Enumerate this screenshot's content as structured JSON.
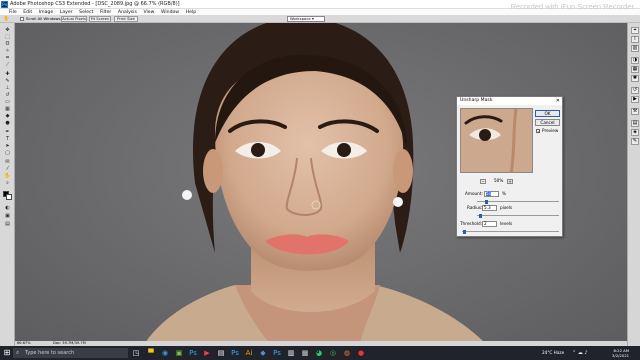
{
  "app": {
    "title": "Adobe Photoshop CS3 Extended - [DSC_2089.jpg @ 66.7% (RGB/8)]",
    "watermark": "Recorded with iFun Screen Recorder"
  },
  "menu": [
    "File",
    "Edit",
    "Image",
    "Layer",
    "Select",
    "Filter",
    "Analysis",
    "View",
    "Window",
    "Help"
  ],
  "options": {
    "scroll_all_label": "Scroll All Windows",
    "actual_pixels": "Actual Pixels",
    "fit_screen": "Fit Screen",
    "print_size": "Print Size",
    "workspace": "Workspace ▾"
  },
  "status": {
    "zoom": "66.67%",
    "doc": "Doc: 39.7M/39.7M"
  },
  "dialog": {
    "title": "Unsharp Mask",
    "ok": "OK",
    "cancel": "Cancel",
    "preview_label": "Preview",
    "preview_checked": true,
    "preview_zoom": "50%",
    "zoom_out": "−",
    "zoom_in": "+",
    "amount_label": "Amount:",
    "amount_value": "51",
    "amount_unit": "%",
    "amount_level": 0.1,
    "radius_label": "Radius:",
    "radius_value": "5.3",
    "radius_unit": "pixels",
    "radius_level": 0.02,
    "threshold_label": "Threshold:",
    "threshold_value": "2",
    "threshold_unit": "levels",
    "threshold_level": 0.01
  },
  "taskbar": {
    "search_placeholder": "Type here to search",
    "weather": "24°C  Haze",
    "time": "8:22 AM",
    "date": "3/2/2021"
  },
  "colors": {
    "foreground": "#000000",
    "background": "#ffffff",
    "accent": "#2a5ea8"
  }
}
